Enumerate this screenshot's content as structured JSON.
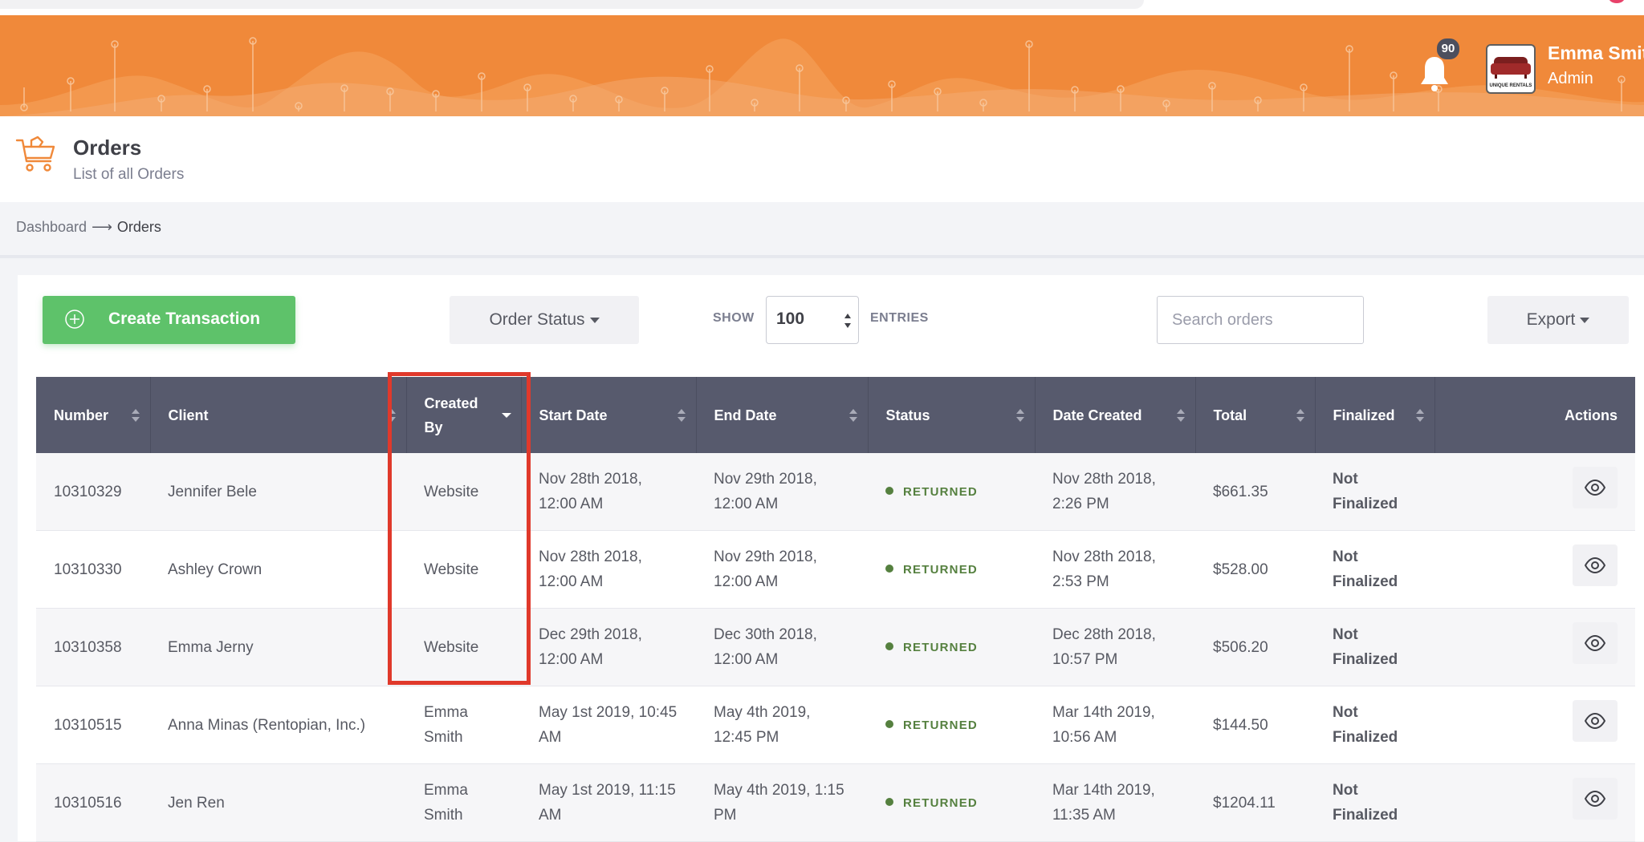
{
  "header": {
    "notification_count": "90",
    "user_name": "Emma Smit",
    "user_role": "Admin",
    "brand_logo_text": "UNIQUE RENTALS",
    "brand_color": "#f0893a"
  },
  "page": {
    "title": "Orders",
    "subtitle": "List of all Orders"
  },
  "breadcrumb": {
    "home": "Dashboard",
    "separator": "⟶",
    "current": "Orders"
  },
  "toolbar": {
    "create_label": "Create Transaction",
    "order_status_label": "Order Status",
    "show_label": "SHOW",
    "entries_value": "100",
    "entries_label": "ENTRIES",
    "search_placeholder": "Search orders",
    "export_label": "Export"
  },
  "table": {
    "columns": [
      "Number",
      "Client",
      "Created By",
      "Start Date",
      "End Date",
      "Status",
      "Date Created",
      "Total",
      "Finalized",
      "Actions"
    ],
    "rows": [
      {
        "number": "10310329",
        "client": "Jennifer Bele",
        "created_by": "Website",
        "start": "Nov 28th 2018, 12:00 AM",
        "end": "Nov 29th 2018, 12:00 AM",
        "status": "RETURNED",
        "created": "Nov 28th 2018, 2:26 PM",
        "total": "$661.35",
        "finalized": "Not Finalized"
      },
      {
        "number": "10310330",
        "client": "Ashley Crown",
        "created_by": "Website",
        "start": "Nov 28th 2018, 12:00 AM",
        "end": "Nov 29th 2018, 12:00 AM",
        "status": "RETURNED",
        "created": "Nov 28th 2018, 2:53 PM",
        "total": "$528.00",
        "finalized": "Not Finalized"
      },
      {
        "number": "10310358",
        "client": "Emma Jerny",
        "created_by": "Website",
        "start": "Dec 29th 2018, 12:00 AM",
        "end": "Dec 30th 2018, 12:00 AM",
        "status": "RETURNED",
        "created": "Dec 28th 2018, 10:57 PM",
        "total": "$506.20",
        "finalized": "Not Finalized"
      },
      {
        "number": "10310515",
        "client": "Anna Minas (Rentopian, Inc.)",
        "created_by": "Emma Smith",
        "start": "May 1st 2019, 10:45 AM",
        "end": "May 4th 2019, 12:45 PM",
        "status": "RETURNED",
        "created": "Mar 14th 2019, 10:56 AM",
        "total": "$144.50",
        "finalized": "Not Finalized"
      },
      {
        "number": "10310516",
        "client": "Jen Ren",
        "created_by": "Emma Smith",
        "start": "May 1st 2019, 11:15 AM",
        "end": "May 4th 2019, 1:15 PM",
        "status": "RETURNED",
        "created": "Mar 14th 2019, 11:35 AM",
        "total": "$1204.11",
        "finalized": "Not Finalized"
      }
    ]
  },
  "colors": {
    "accent": "#f0893a",
    "create_button": "#5ec26a",
    "table_header": "#575a6d",
    "status_returned": "#55803f",
    "highlight_box": "#e0392b"
  },
  "icons": {
    "bell": "bell-icon",
    "cart": "cart-icon",
    "plus": "plus-circle-icon",
    "view": "eye-icon",
    "sort": "sort-arrows-icon"
  }
}
